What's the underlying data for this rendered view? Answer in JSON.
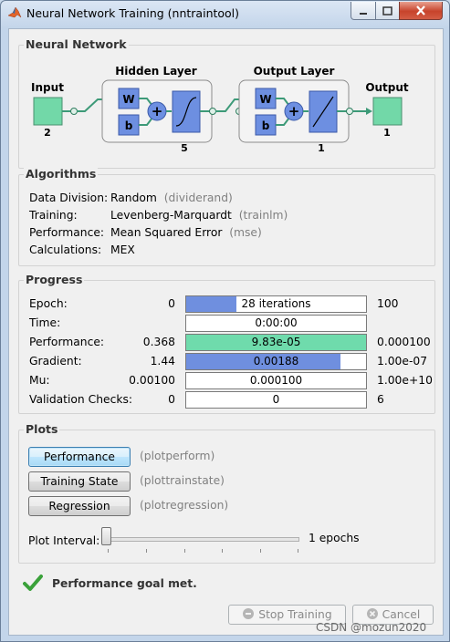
{
  "window": {
    "title": "Neural Network Training (nntraintool)"
  },
  "network": {
    "section_title": "Neural Network",
    "input_label": "Input",
    "input_size": "2",
    "hidden_label": "Hidden Layer",
    "hidden_size": "5",
    "output_layer_label": "Output Layer",
    "output_layer_size": "1",
    "output_label": "Output",
    "output_size": "1",
    "weight_symbol": "W",
    "bias_symbol": "b",
    "sum_symbol": "+"
  },
  "algorithms": {
    "section_title": "Algorithms",
    "rows": [
      {
        "label": "Data Division:",
        "value": "Random",
        "fn": "(dividerand)"
      },
      {
        "label": "Training:",
        "value": "Levenberg-Marquardt",
        "fn": "(trainlm)"
      },
      {
        "label": "Performance:",
        "value": "Mean Squared Error",
        "fn": "(mse)"
      },
      {
        "label": "Calculations:",
        "value": "MEX",
        "fn": ""
      }
    ]
  },
  "progress": {
    "section_title": "Progress",
    "rows": [
      {
        "label": "Epoch:",
        "min": "0",
        "text": "28 iterations",
        "max": "100",
        "fill": 0.28,
        "color": "#6f8fdf"
      },
      {
        "label": "Time:",
        "min": "",
        "text": "0:00:00",
        "max": "",
        "fill": 0,
        "color": "#6f8fdf"
      },
      {
        "label": "Performance:",
        "min": "0.368",
        "text": "9.83e-05",
        "max": "0.000100",
        "fill": 1.0,
        "color": "#6fdbac"
      },
      {
        "label": "Gradient:",
        "min": "1.44",
        "text": "0.00188",
        "max": "1.00e-07",
        "fill": 0.86,
        "color": "#6f8fdf"
      },
      {
        "label": "Mu:",
        "min": "0.00100",
        "text": "0.000100",
        "max": "1.00e+10",
        "fill": 0,
        "color": "#6f8fdf"
      },
      {
        "label": "Validation Checks:",
        "min": "0",
        "text": "0",
        "max": "6",
        "fill": 0,
        "color": "#6f8fdf"
      }
    ]
  },
  "plots": {
    "section_title": "Plots",
    "buttons": [
      {
        "label": "Performance",
        "fn": "(plotperform)"
      },
      {
        "label": "Training State",
        "fn": "(plottrainstate)"
      },
      {
        "label": "Regression",
        "fn": "(plotregression)"
      }
    ],
    "interval_label": "Plot Interval:",
    "interval_value": "1 epochs",
    "slider_value": 1
  },
  "status": {
    "message": "Performance goal met."
  },
  "footer": {
    "stop_label": "Stop Training",
    "cancel_label": "Cancel"
  },
  "watermark": "CSDN @mozun2020",
  "colors": {
    "layer_fill": "#6d8fe1",
    "io_fill": "#72d8a8",
    "goal_check": "#3aa13a"
  }
}
